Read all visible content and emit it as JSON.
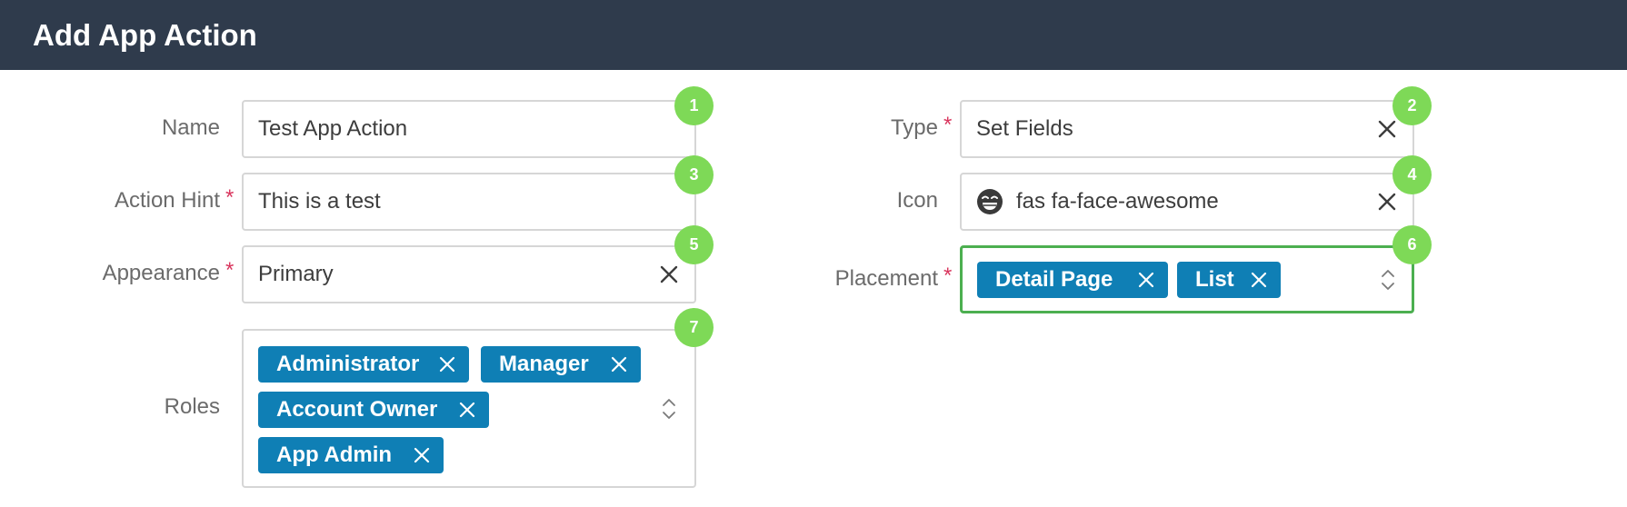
{
  "header": {
    "title": "Add App Action"
  },
  "left": {
    "name": {
      "label": "Name",
      "value": "Test App Action",
      "badge": "1"
    },
    "action_hint": {
      "label": "Action Hint",
      "required": "*",
      "value": "This is a test",
      "badge": "3"
    },
    "appearance": {
      "label": "Appearance",
      "required": "*",
      "value": "Primary",
      "badge": "5"
    },
    "roles": {
      "label": "Roles",
      "badge": "7",
      "tags": [
        "Administrator",
        "Manager",
        "Account Owner",
        "App Admin"
      ]
    }
  },
  "right": {
    "type": {
      "label": "Type",
      "required": "*",
      "value": "Set Fields",
      "badge": "2"
    },
    "icon": {
      "label": "Icon",
      "value": "fas fa-face-awesome",
      "icon_name": "face-awesome-icon",
      "badge": "4"
    },
    "placement": {
      "label": "Placement",
      "required": "*",
      "badge": "6",
      "tags": [
        "Detail Page",
        "List"
      ]
    }
  },
  "colors": {
    "header_bg": "#2f3b4c",
    "tag_bg": "#0f7fb5",
    "badge_bg": "#7ed957",
    "required": "#d9365e",
    "focus_border": "#4caf50"
  }
}
